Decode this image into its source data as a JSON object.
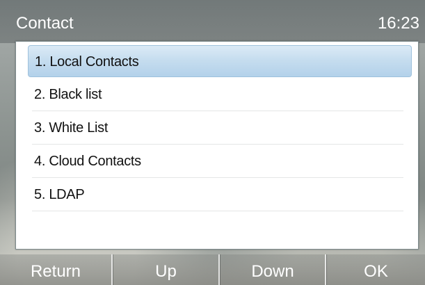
{
  "header": {
    "title": "Contact",
    "time": "16:23"
  },
  "menu": {
    "selected_index": 0,
    "items": [
      {
        "label": "1. Local Contacts"
      },
      {
        "label": "2. Black list"
      },
      {
        "label": "3. White List"
      },
      {
        "label": "4. Cloud Contacts"
      },
      {
        "label": "5. LDAP"
      }
    ]
  },
  "softkeys": {
    "return_label": "Return",
    "up_label": "Up",
    "down_label": "Down",
    "ok_label": "OK"
  },
  "colors": {
    "selection_highlight": "#c6ddef",
    "panel_background": "#ffffff",
    "text": "#111111",
    "header_text": "#ffffff"
  }
}
